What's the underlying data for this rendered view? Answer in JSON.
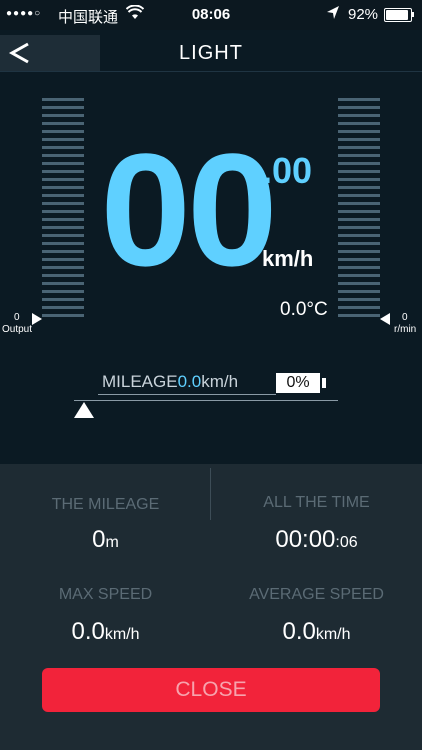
{
  "status_bar": {
    "signal": "●●●●○",
    "carrier": "中国联通",
    "time": "08:06",
    "battery": "92%",
    "battery_level": 0.92
  },
  "header": {
    "title": "LIGHT",
    "back_icon": "back-arrow-icon"
  },
  "gauges": {
    "left_value": "0",
    "left_label": "Output",
    "right_value": "0",
    "right_label": "r/min",
    "tick_count": 28,
    "tick_color": "#4a6474"
  },
  "speedometer": {
    "speed": "00",
    "decimal": ".00",
    "unit": "km/h",
    "temperature": "0.0°C",
    "accent_color": "#5fd0ff"
  },
  "mileage_bar": {
    "label": "MILEAGE",
    "value": "0.0",
    "unit": "km/h",
    "battery_percent": "0%",
    "slider_position": 0
  },
  "stats": {
    "the_mileage_label": "THE MILEAGE",
    "the_mileage_value": "0",
    "the_mileage_unit": "m",
    "all_time_label": "ALL THE TIME",
    "all_time_value": "00:00",
    "all_time_suffix": ":06",
    "max_speed_label": "MAX SPEED",
    "max_speed_value": "0.0",
    "max_speed_unit": "km/h",
    "avg_speed_label": "AVERAGE SPEED",
    "avg_speed_value": "0.0",
    "avg_speed_unit": "km/h"
  },
  "close_button": {
    "label": "CLOSE",
    "color": "#f2233a"
  }
}
